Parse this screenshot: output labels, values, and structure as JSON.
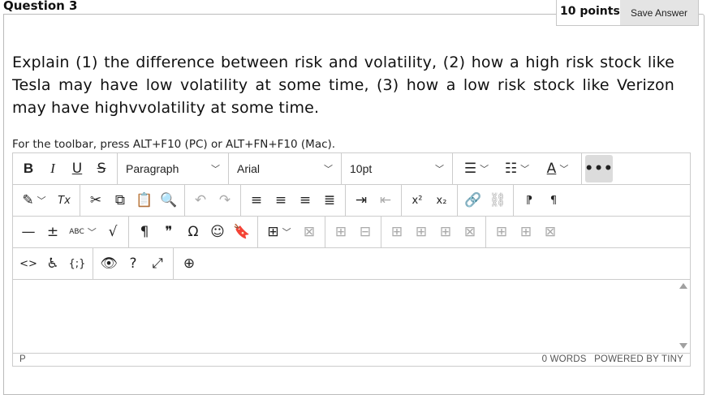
{
  "question": {
    "title": "Question 3",
    "points": "10 points",
    "save_label": "Save Answer",
    "text": "Explain (1) the difference between risk and volatility, (2) how a high risk stock like Tesla may have low volatility at some time, (3) how a low risk stock like Verizon may have highvvolatility at some time."
  },
  "editor": {
    "toolbar_hint": "For the toolbar, press ALT+F10 (PC) or ALT+FN+F10 (Mac).",
    "block_format": "Paragraph",
    "font_family": "Arial",
    "font_size": "10pt",
    "status_path": "P",
    "word_count": "0 WORDS",
    "powered_by": "POWERED BY TINY",
    "icons": {
      "bold": "B",
      "italic": "I",
      "underline": "U",
      "strikethrough": "S",
      "more": "•••",
      "clear_format": "Tx",
      "cut": "✂",
      "copy": "⧉",
      "paste": "📋",
      "find": "🔍",
      "undo": "↶",
      "redo": "↷",
      "superscript": "x²",
      "subscript": "x₂",
      "link": "🔗",
      "unlink": "⛓",
      "ltr": "⁋",
      "rtl": "¶",
      "hr": "—",
      "plusminus": "±",
      "spell": "ABC",
      "math": "√",
      "pilcrow": "¶",
      "quote": "❞",
      "omega": "Ω",
      "emoji": "☺",
      "bookmark": "🔖",
      "code": "<>",
      "accessibility": "♿",
      "template": "{;}",
      "preview": "👁",
      "help": "?",
      "fullscreen": "⤢",
      "add": "⊕"
    }
  }
}
